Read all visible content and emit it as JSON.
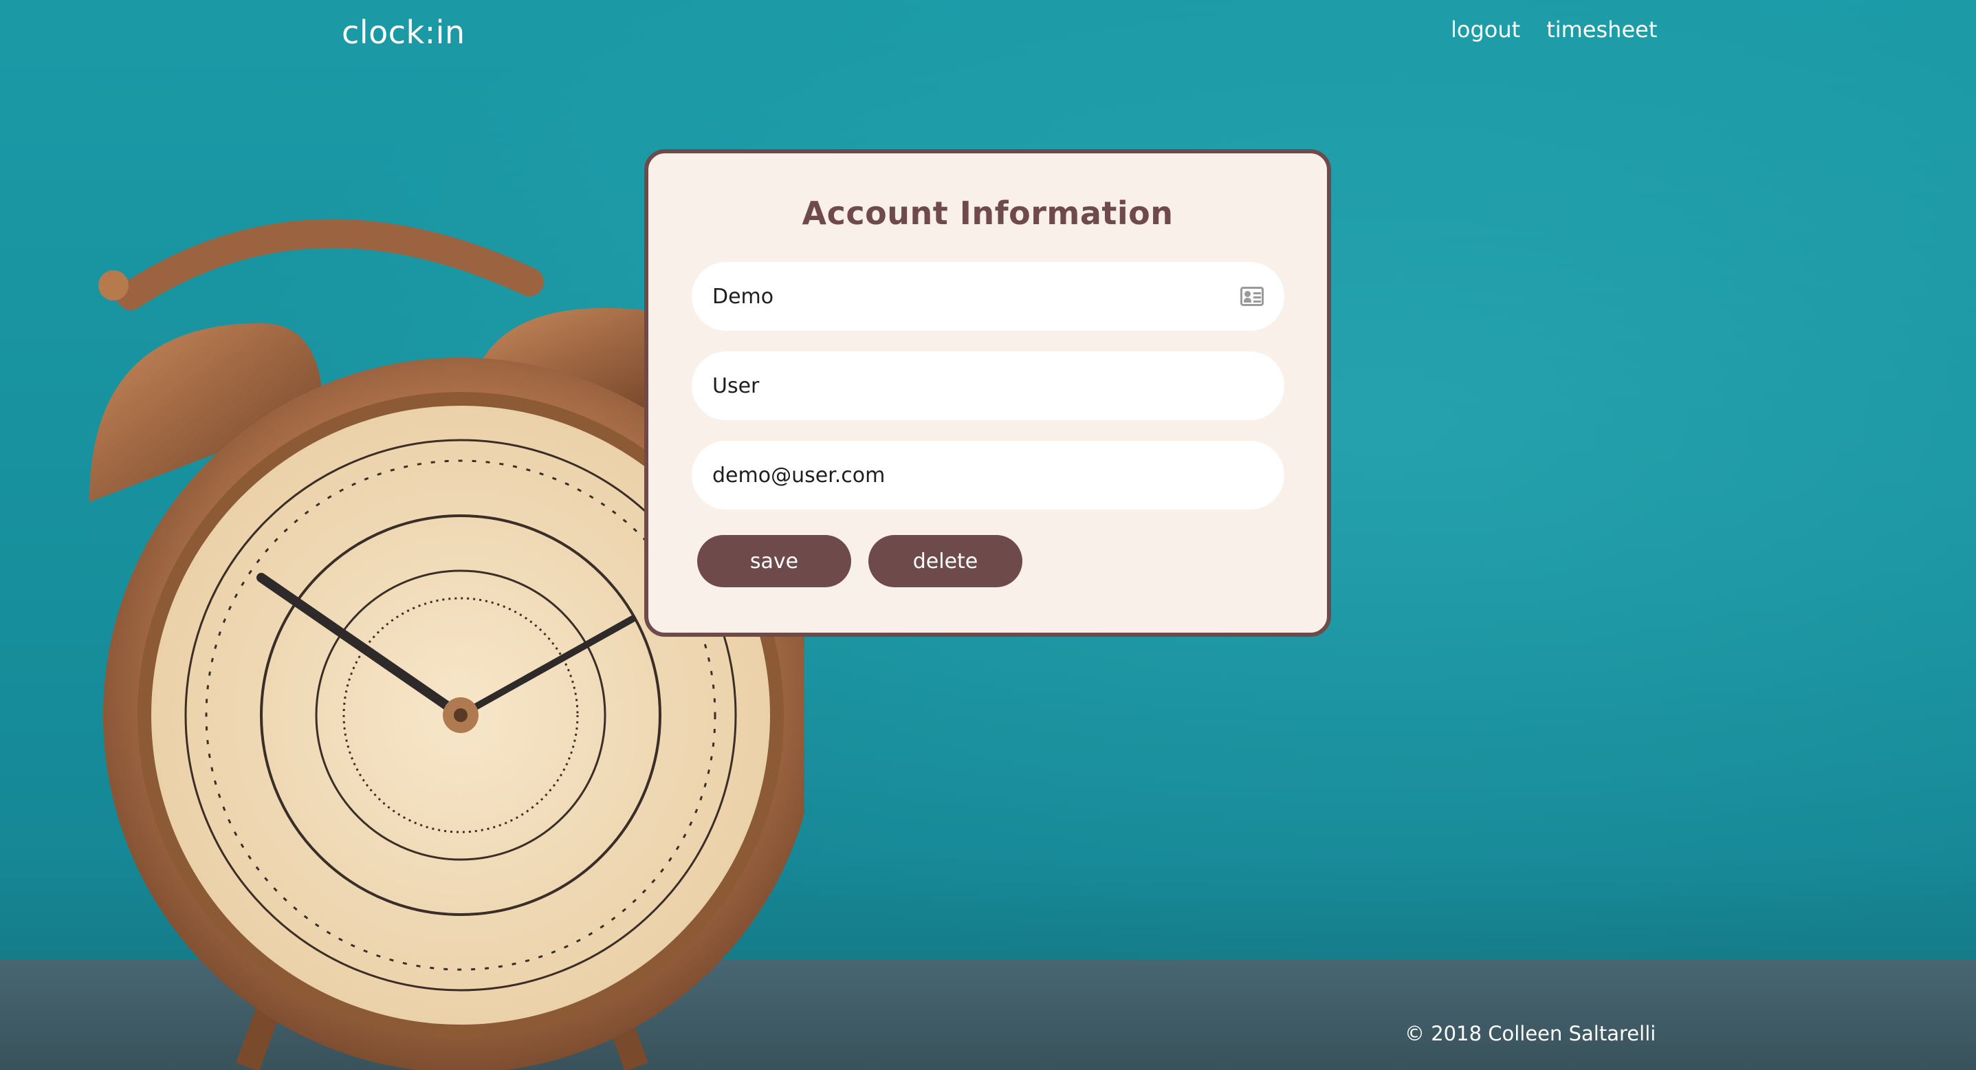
{
  "header": {
    "brand": "clock:in",
    "nav": [
      {
        "label": "logout"
      },
      {
        "label": "timesheet"
      }
    ]
  },
  "card": {
    "title": "Account Information",
    "fields": [
      {
        "value": "Demo",
        "icon": "contact-card-icon"
      },
      {
        "value": "User"
      },
      {
        "value": "demo@user.com"
      }
    ],
    "buttons": {
      "save": "save",
      "delete": "delete"
    }
  },
  "footer": {
    "copyright": "© 2018 Colleen Saltarelli"
  },
  "colors": {
    "background": "#1b9aa6",
    "card": "#faf0ea",
    "accent": "#6e4a4b",
    "text_light": "#ffffff"
  }
}
